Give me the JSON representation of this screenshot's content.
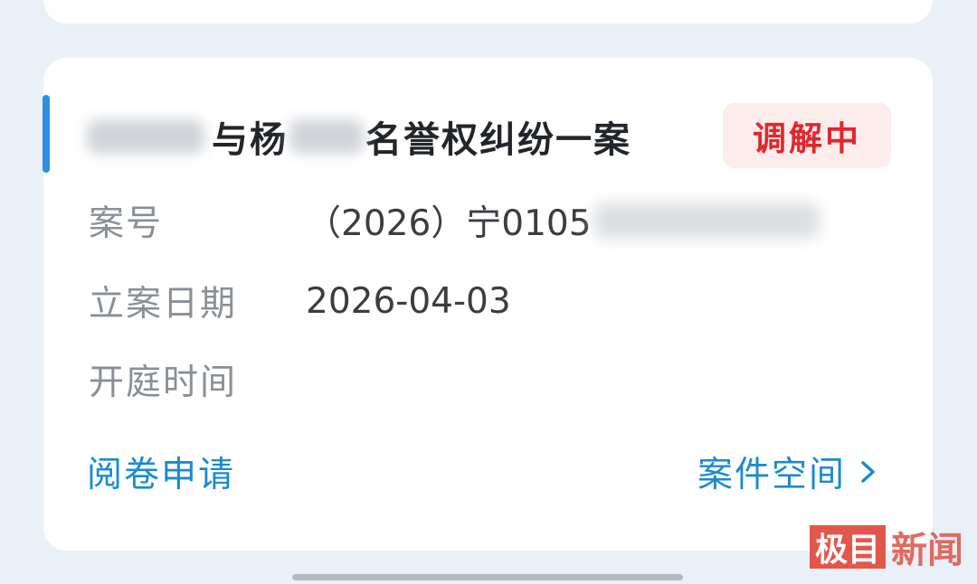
{
  "case_card": {
    "title_part1": "与杨",
    "title_part2": "名誉权纠纷一案",
    "status": "调解中",
    "fields": [
      {
        "label": "案号",
        "value": "（2026）宁0105"
      },
      {
        "label": "立案日期",
        "value": "2026-04-03"
      },
      {
        "label": "开庭时间",
        "value": ""
      }
    ],
    "link_left": "阅卷申请",
    "link_right": "案件空间"
  },
  "watermark": {
    "box_text": "极目",
    "text": "新闻"
  },
  "colors": {
    "accent": "#2c8fe3",
    "status_text": "#e0272d",
    "status_bg": "#fdecec",
    "link": "#1a8bcf"
  },
  "icons": [
    "chevron-right-icon"
  ]
}
